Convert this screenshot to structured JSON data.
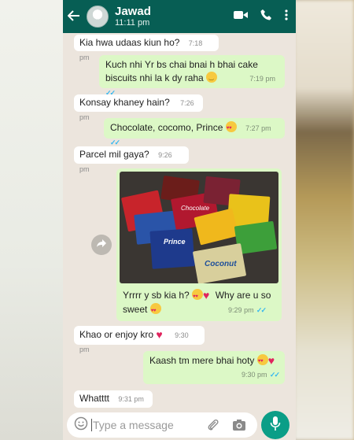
{
  "header": {
    "contact_name": "Jawad",
    "status": "11:11 pm",
    "bar_color": "#075e54"
  },
  "messages": [
    {
      "dir": "in",
      "text": "Kia hwa udaas kiun ho?",
      "time": "7:18 pm"
    },
    {
      "dir": "out",
      "line1": "Kuch nhi Yr bs chai bnai h bhai cake",
      "line2": "biscuits nhi la k dy raha",
      "time": "7:19 pm"
    },
    {
      "dir": "in",
      "text": "Konsay khaney hain?",
      "time": "7:26 pm"
    },
    {
      "dir": "out",
      "text": "Chocolate, cocomo, Prince",
      "time": "7:27 pm"
    },
    {
      "dir": "in",
      "text": "Parcel mil gaya?",
      "time": "9:26 pm"
    },
    {
      "dir": "out",
      "line1": "Yrrrr y sb kia h?",
      "line1b": "Why are u so",
      "line2": "sweet",
      "time": "9:29 pm"
    },
    {
      "dir": "in",
      "text": "Khao or enjoy kro",
      "time": "9:30 pm"
    },
    {
      "dir": "out",
      "text": "Kaash tm mere bhai hoty",
      "time": "9:30 pm"
    },
    {
      "dir": "in",
      "text": "Whatttt",
      "time": "9:31 pm"
    }
  ],
  "photo": {
    "labels": [
      "Coconut",
      "Prince",
      "Chocolate"
    ]
  },
  "composer": {
    "placeholder": "Type a message",
    "icons": [
      "emoji-icon",
      "attach-icon",
      "camera-icon",
      "mic-icon"
    ]
  },
  "colors": {
    "incoming": "#ffffff",
    "outgoing": "#dcf8c6",
    "read_ticks": "#34b7f1",
    "chat_bg": "#ece5dd",
    "mic_button": "#0a9e87"
  }
}
